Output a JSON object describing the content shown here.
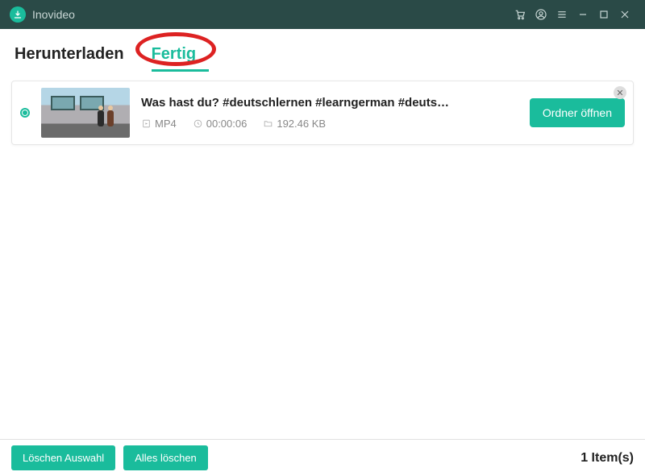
{
  "app": {
    "name": "Inovideo"
  },
  "tabs": {
    "download": "Herunterladen",
    "done": "Fertig",
    "active": "done"
  },
  "items": [
    {
      "title": "Was hast du? #deutschlernen #learngerman #deuts…",
      "format": "MP4",
      "duration": "00:00:06",
      "size": "192.46 KB",
      "open_label": "Ordner öffnen"
    }
  ],
  "footer": {
    "delete_selection": "Löschen Auswahl",
    "delete_all": "Alles löschen",
    "count_text": "1 Item(s)"
  },
  "colors": {
    "accent": "#1abc9c",
    "titlebar": "#2a4a47"
  }
}
